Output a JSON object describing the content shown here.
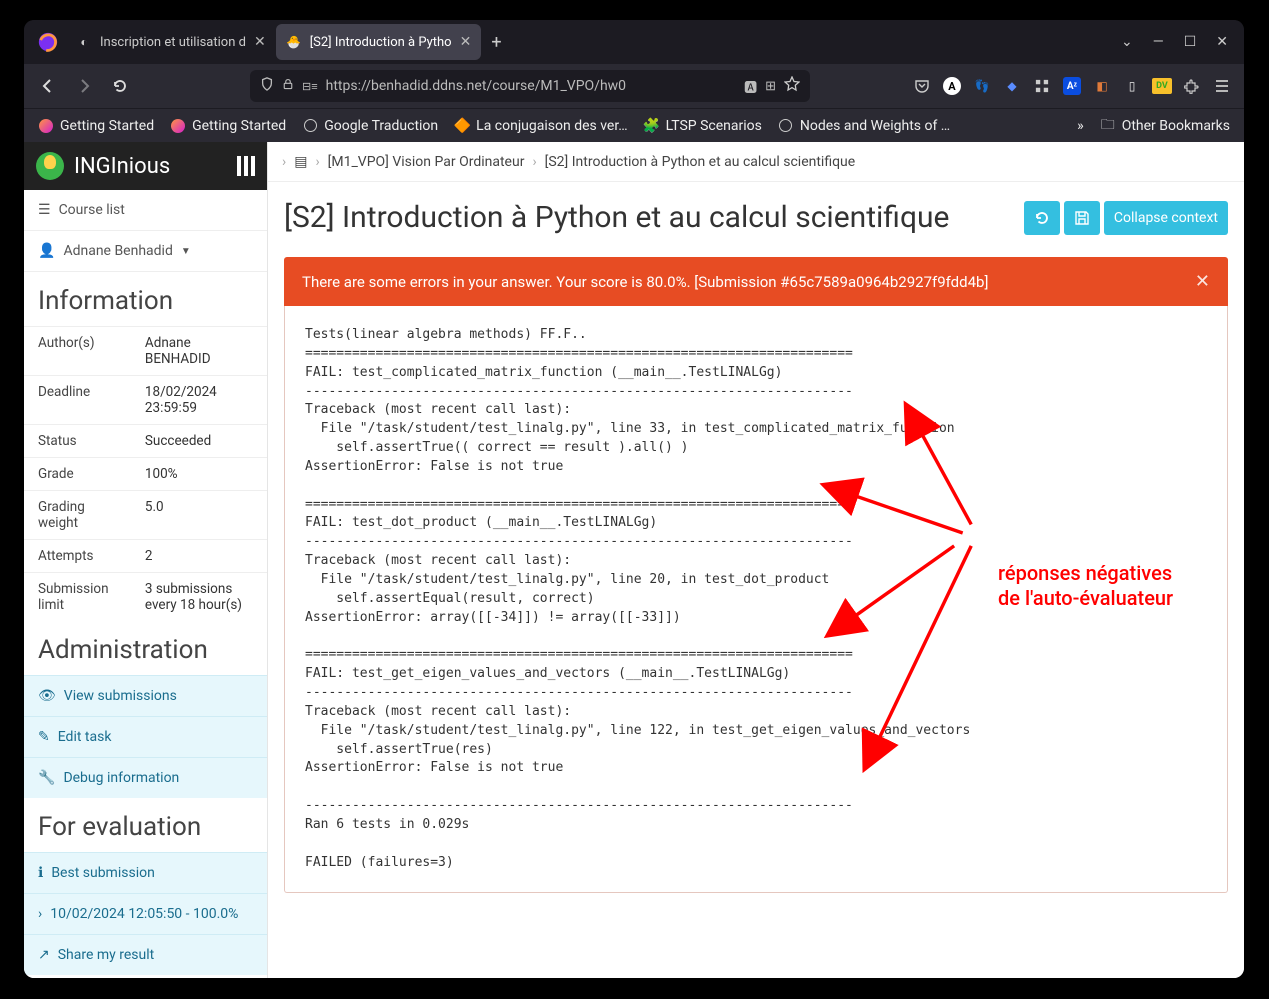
{
  "tabs": [
    {
      "label": "Inscription et utilisation d",
      "active": false
    },
    {
      "label": "[S2] Introduction à Pytho",
      "active": true
    }
  ],
  "winctrls": {
    "down": "⌄",
    "min": "—",
    "max": "☐",
    "close": "✕"
  },
  "url": "https://benhadid.ddns.net/course/M1_VPO/hw0",
  "bookmarks": [
    "Getting Started",
    "Getting Started",
    "Google Traduction",
    "La conjugaison des ver…",
    "LTSP Scenarios",
    "Nodes and Weights of …"
  ],
  "bookbar_more": "»",
  "bookbar_other": "Other Bookmarks",
  "brand": "INGInious",
  "side": {
    "course_list": "Course list",
    "user": "Adnane Benhadid"
  },
  "info_title": "Information",
  "info_rows": [
    [
      "Author(s)",
      "Adnane BENHADID"
    ],
    [
      "Deadline",
      "18/02/2024 23:59:59"
    ],
    [
      "Status",
      "Succeeded"
    ],
    [
      "Grade",
      "100%"
    ],
    [
      "Grading weight",
      "5.0"
    ],
    [
      "Attempts",
      "2"
    ],
    [
      "Submission limit",
      "3 submissions every 18 hour(s)"
    ]
  ],
  "admin_title": "Administration",
  "admin_items": [
    "View submissions",
    "Edit task",
    "Debug information"
  ],
  "eval_title": "For evaluation",
  "eval_items": [
    "Best submission",
    "10/02/2024 12:05:50 - 100.0%",
    "Share my result"
  ],
  "crumbs": {
    "course": "[M1_VPO] Vision Par Ordinateur",
    "task": "[S2] Introduction à Python et au calcul scientifique"
  },
  "page_title": "[S2] Introduction à Python et au calcul scientifique",
  "head_buttons": {
    "collapse": "Collapse context"
  },
  "alert": "There are some errors in your answer. Your score is 80.0%. [Submission #65c7589a0964b2927f9fdd4b]",
  "result_output": "Tests(linear algebra methods) FF.F..\n======================================================================\nFAIL: test_complicated_matrix_function (__main__.TestLINALGg)\n----------------------------------------------------------------------\nTraceback (most recent call last):\n  File \"/task/student/test_linalg.py\", line 33, in test_complicated_matrix_function\n    self.assertTrue(( correct == result ).all() )\nAssertionError: False is not true\n\n======================================================================\nFAIL: test_dot_product (__main__.TestLINALGg)\n----------------------------------------------------------------------\nTraceback (most recent call last):\n  File \"/task/student/test_linalg.py\", line 20, in test_dot_product\n    self.assertEqual(result, correct)\nAssertionError: array([[-34]]) != array([[-33]])\n\n======================================================================\nFAIL: test_get_eigen_values_and_vectors (__main__.TestLINALGg)\n----------------------------------------------------------------------\nTraceback (most recent call last):\n  File \"/task/student/test_linalg.py\", line 122, in test_get_eigen_values_and_vectors\n    self.assertTrue(res)\nAssertionError: False is not true\n\n----------------------------------------------------------------------\nRan 6 tests in 0.029s\n\nFAILED (failures=3)",
  "annotation": {
    "line1": "réponses négatives",
    "line2": "de l'auto-évaluateur"
  }
}
